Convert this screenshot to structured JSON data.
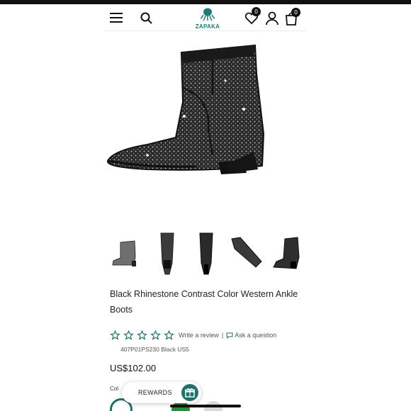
{
  "brand": {
    "name": "ZAPAKA",
    "color": "#1f7a74"
  },
  "header": {
    "menu_icon": "hamburger-icon",
    "search_icon": "search-icon",
    "wishlist_count": "0",
    "cart_count": "0"
  },
  "gallery": {
    "main_image": "black rhinestone western ankle boot",
    "thumbnails": [
      "side view",
      "front pair view",
      "back pair view",
      "top view",
      "angled view"
    ]
  },
  "product": {
    "title": "Black Rhinestone Contrast Color Western Ankle Boots",
    "rating_stars": 0,
    "write_review_label": "Write a review",
    "separator": "|",
    "ask_question_label": "Ask a question",
    "sku_line": "407P01PS230 Black US5",
    "price": "US$102.00",
    "color_label": "Col"
  },
  "rewards": {
    "label": "REWARDS",
    "accent": "#1f6f6b"
  }
}
